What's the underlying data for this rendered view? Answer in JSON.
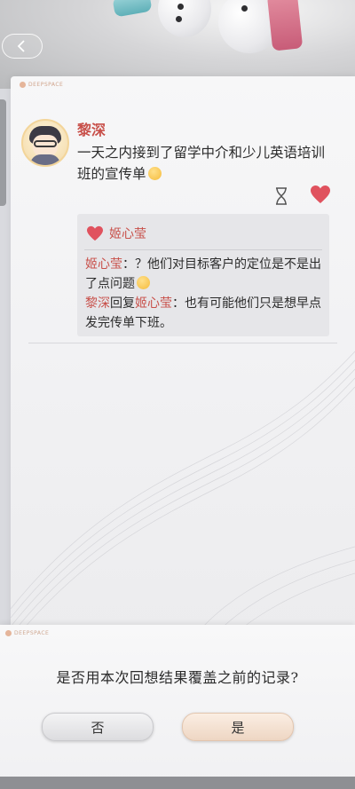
{
  "header": {
    "back_icon": "chevron-left-icon"
  },
  "card": {
    "brand": "DEEPSPACE"
  },
  "post": {
    "author": "黎深",
    "text": "一天之内接到了留学中介和少儿英语培训班的宣传单",
    "liked": true
  },
  "comments_panel": {
    "like_name": "姬心莹",
    "comments": [
      {
        "author": "姬心莹",
        "sep": "：",
        "text": "？他们对目标客户的定位是不是出了点问题"
      },
      {
        "author": "黎深",
        "reply": "回复",
        "target": "姬心莹",
        "sep": "：",
        "text": "也有可能他们只是想早点发完传单下班。"
      }
    ]
  },
  "dialog": {
    "brand": "DEEPSPACE",
    "message": "是否用本次回想结果覆盖之前的记录?",
    "no_label": "否",
    "yes_label": "是"
  },
  "colors": {
    "accent": "#c8504a",
    "heart": "#e0525e"
  }
}
